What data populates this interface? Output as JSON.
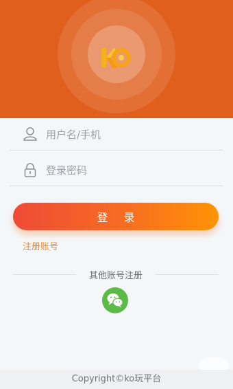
{
  "brand": {
    "logo_icon": "ko-logo-icon",
    "header_color": "#e05f1d"
  },
  "login_form": {
    "username": {
      "placeholder": "用户名/手机",
      "value": "",
      "icon": "user-icon"
    },
    "password": {
      "placeholder": "登录密码",
      "value": "",
      "icon": "lock-icon"
    },
    "login_button_label": "登 录",
    "register_link": "注册账号"
  },
  "other_login": {
    "divider_text": "其他账号注册",
    "wechat_icon": "wechat-icon"
  },
  "footer": {
    "copyright": "Copyright©ko玩平台"
  },
  "colors": {
    "accent_start": "#ee4a36",
    "accent_end": "#ff9306",
    "link": "#f0862e",
    "wechat": "#5cba47"
  }
}
